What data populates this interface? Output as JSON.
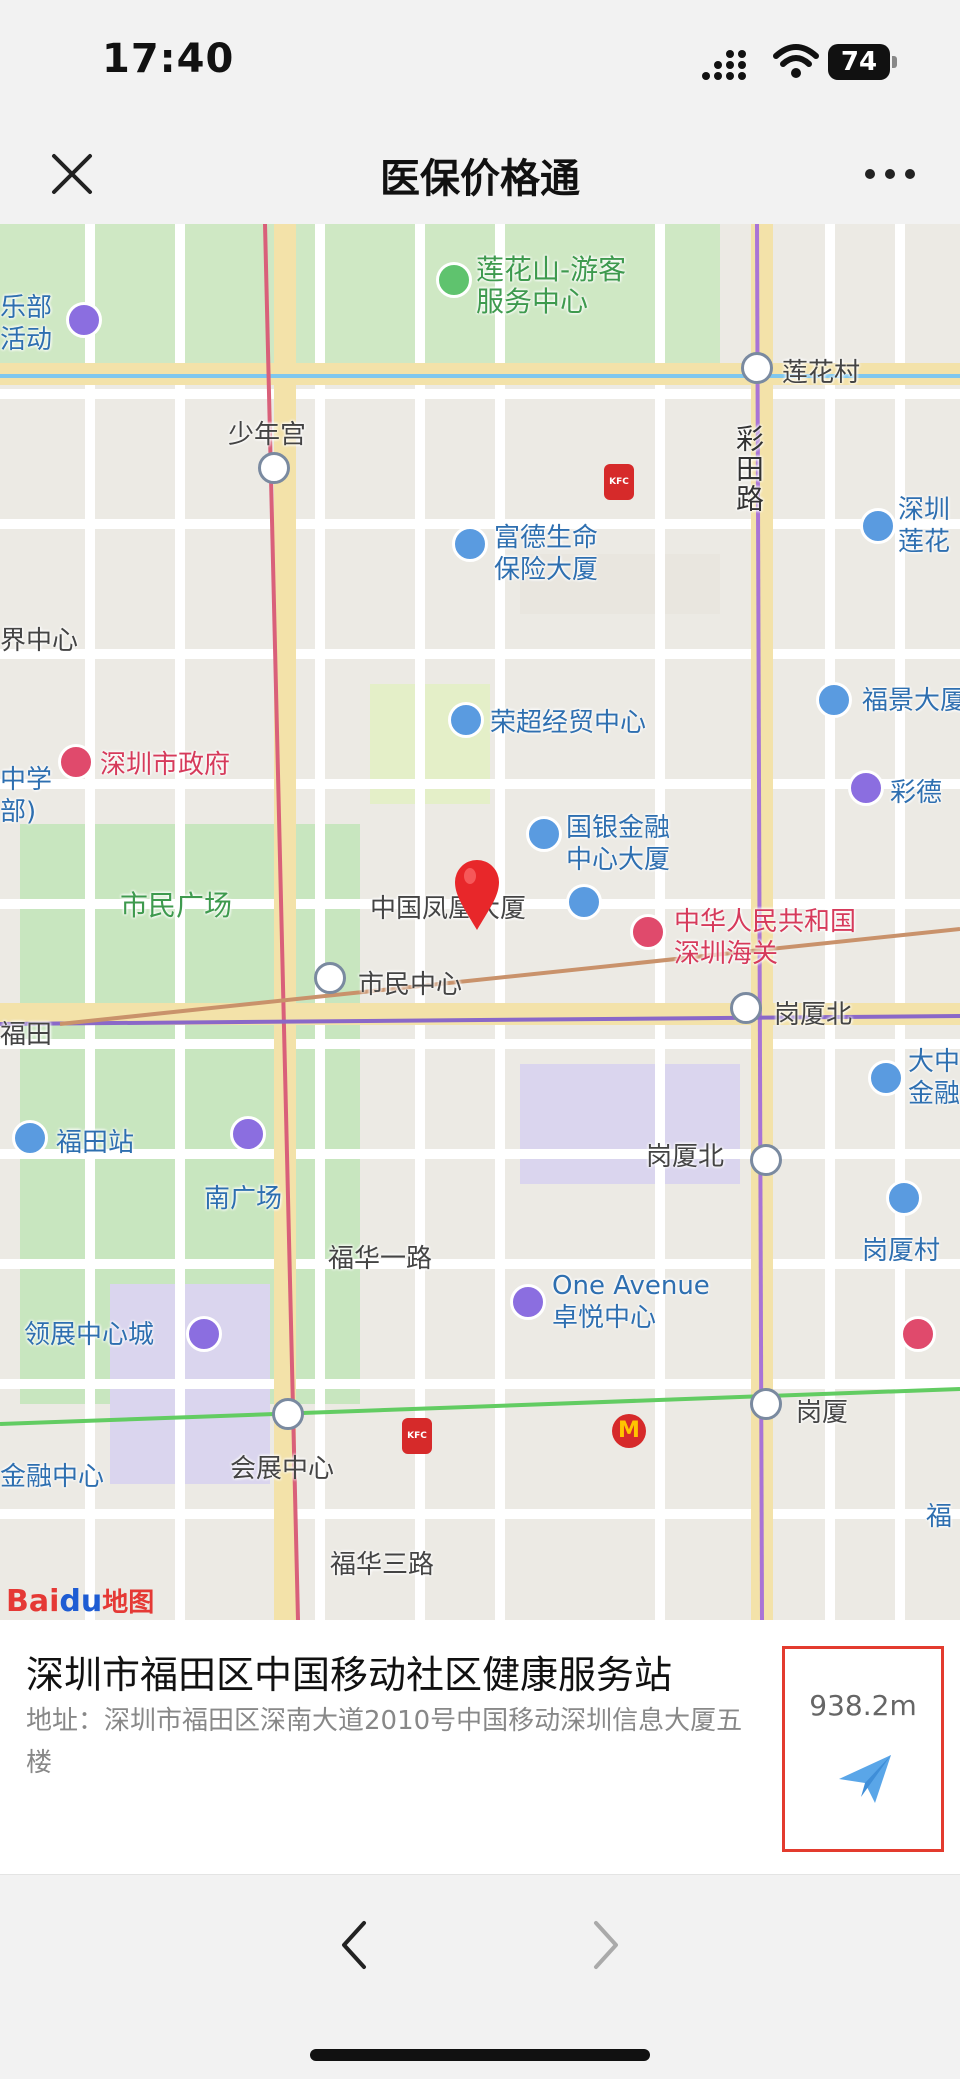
{
  "status": {
    "time": "17:40",
    "battery": "74"
  },
  "nav": {
    "title": "医保价格通"
  },
  "map": {
    "labels": {
      "lianhuashan": "莲花山-游客\n服务中心",
      "lebu": "乐部\n活动",
      "lianhuacun": "莲花村",
      "shaoniangong": "少年宫",
      "caitianlu": "彩田路",
      "fude": "富德生命\n保险大厦",
      "shenzhen_lianhua": "深圳\n莲花",
      "jiezhongxin": "界中心",
      "fujing": "福景大厦",
      "rongchao": "荣超经贸中心",
      "caide": "彩德",
      "zhengfu": "深圳市政府",
      "zhongxue": "中学\n部)",
      "guoyin": "国银金融\n中心大厦",
      "shiminguangchang": "市民广场",
      "fenghuang": "中国凤凰大厦",
      "haiguan": "中华人民共和国\n深圳海关",
      "shiminzhongxin": "市民中心",
      "futian": "福田",
      "gangxiabei1": "岗厦北",
      "dazhong": "大中\n金融",
      "futianzhan": "福田站",
      "nanguangchang": "南广场",
      "gangxiabei2": "岗厦北",
      "gangxiacun": "岗厦村",
      "fuhuayilu": "福华一路",
      "oneavenue": "One Avenue\n卓悦中心",
      "lingzhan": "领展中心城",
      "gangxia": "岗厦",
      "huizhan": "会展中心",
      "jinrongzhongxin": "金融中心",
      "fuhuasanlu": "福华三路",
      "fu": "福",
      "kfc": "KFC",
      "mcd": "M"
    },
    "logo": {
      "part1": "Bai",
      "part2": "du",
      "part3": "地图"
    }
  },
  "info": {
    "name": "深圳市福田区中国移动社区健康服务站",
    "address": "地址：深圳市福田区深南大道2010号中国移动深圳信息大厦五楼",
    "distance": "938.2m"
  },
  "colors": {
    "accent": "#5aa6e8",
    "highlight_border": "#e33b2e",
    "marker": "#e8272a"
  }
}
